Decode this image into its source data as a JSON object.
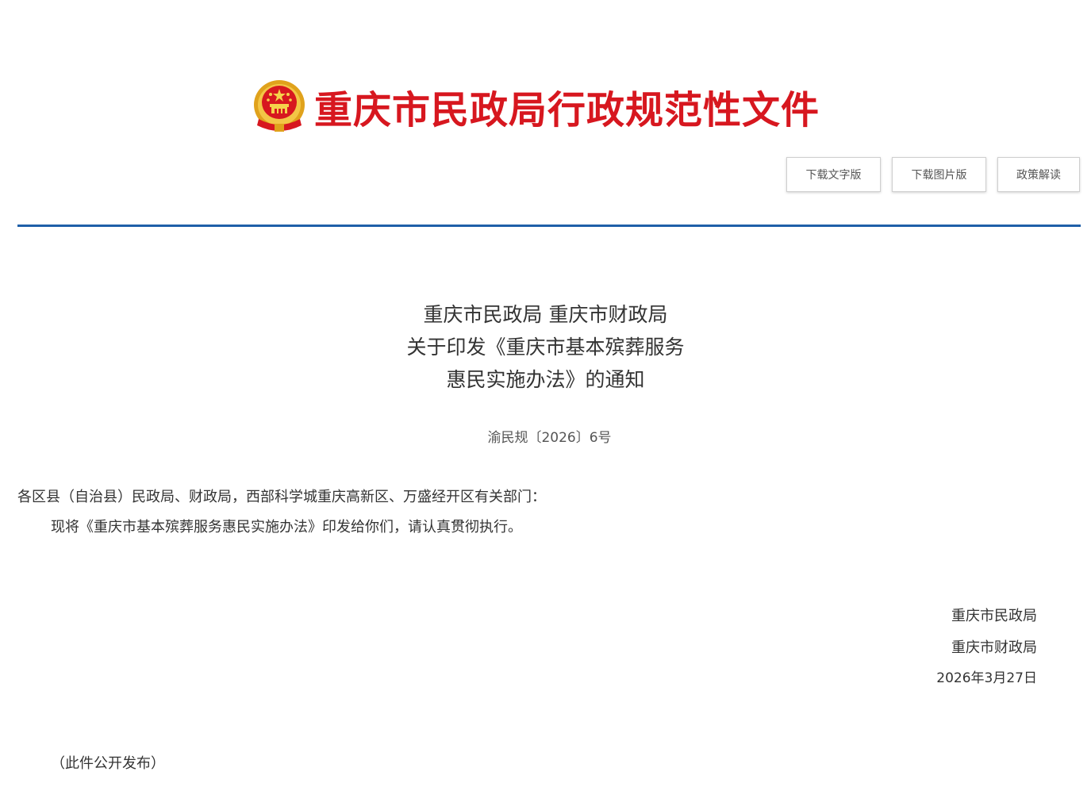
{
  "header": {
    "emblem_icon": "national-emblem-icon",
    "title": "重庆市民政局行政规范性文件",
    "title_color": "#d7171f"
  },
  "toolbar": {
    "download_text_label": "下载文字版",
    "download_image_label": "下载图片版",
    "interpretation_label": "政策解读"
  },
  "divider_color": "#1f5fa8",
  "document": {
    "title_lines": [
      "重庆市民政局 重庆市财政局",
      "关于印发《重庆市基本殡葬服务",
      "惠民实施办法》的通知"
    ],
    "doc_number": "渝民规〔2026〕6号",
    "recipients": "各区县（自治县）民政局、财政局，西部科学城重庆高新区、万盛经开区有关部门：",
    "body": "现将《重庆市基本殡葬服务惠民实施办法》印发给你们，请认真贯彻执行。",
    "signatories": [
      "重庆市民政局",
      "重庆市财政局"
    ],
    "date": "2026年3月27日",
    "publish_note": "（此件公开发布）"
  }
}
